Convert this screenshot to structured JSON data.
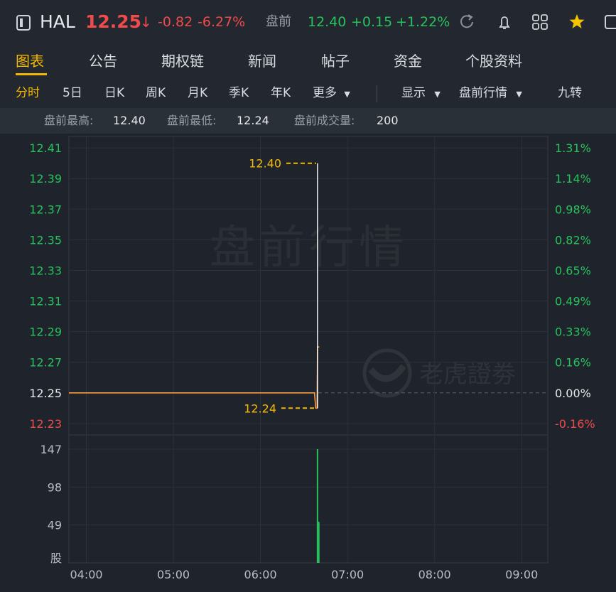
{
  "header": {
    "symbol": "HAL",
    "price": "12.25",
    "arrow": "↓",
    "change": "-0.82",
    "change_pct": "-6.27%",
    "session_label": "盘前",
    "session_price": "12.40",
    "session_change": "+0.15",
    "session_change_pct": "+1.22%"
  },
  "tabs": [
    {
      "label": "图表"
    },
    {
      "label": "公告"
    },
    {
      "label": "期权链"
    },
    {
      "label": "新闻"
    },
    {
      "label": "帖子"
    },
    {
      "label": "资金"
    },
    {
      "label": "个股资料"
    }
  ],
  "periods": [
    {
      "label": "分时"
    },
    {
      "label": "5日"
    },
    {
      "label": "日K"
    },
    {
      "label": "周K"
    },
    {
      "label": "月K"
    },
    {
      "label": "季K"
    },
    {
      "label": "年K"
    },
    {
      "label": "更多"
    }
  ],
  "options": {
    "display_label": "显示",
    "session_label": "盘前行情",
    "nine_turn_label": "九转"
  },
  "info": {
    "high_label": "盘前最高:",
    "high_value": "12.40",
    "low_label": "盘前最低:",
    "low_value": "12.24",
    "volume_label": "盘前成交量:",
    "volume_value": "200"
  },
  "watermarks": {
    "session": "盘前行情",
    "brand": "老虎證劵"
  },
  "colors": {
    "up": "#27c25c",
    "down": "#f04a4a",
    "accent": "#f5b800",
    "price_line": "#ff9a3c",
    "background": "#1f242c"
  },
  "chart_data": {
    "type": "line",
    "title": "",
    "x_ticks": [
      "04:00",
      "05:00",
      "06:00",
      "07:00",
      "08:00",
      "09:00"
    ],
    "y_ticks": [
      {
        "price": "12.41",
        "pct": "1.31%"
      },
      {
        "price": "12.39",
        "pct": "1.14%"
      },
      {
        "price": "12.37",
        "pct": "0.98%"
      },
      {
        "price": "12.35",
        "pct": "0.82%"
      },
      {
        "price": "12.33",
        "pct": "0.65%"
      },
      {
        "price": "12.31",
        "pct": "0.49%"
      },
      {
        "price": "12.29",
        "pct": "0.33%"
      },
      {
        "price": "12.27",
        "pct": "0.16%"
      },
      {
        "price": "12.25",
        "pct": "0.00%"
      },
      {
        "price": "12.23",
        "pct": "-0.16%"
      }
    ],
    "ylim": [
      12.2225,
      12.4175
    ],
    "xlim_hours": [
      3.8,
      9.3
    ],
    "prev_close": 12.25,
    "price_series": {
      "hours": [
        3.8,
        6.62,
        6.635,
        6.65,
        6.655,
        6.665,
        6.675
      ],
      "values": [
        12.25,
        12.25,
        12.24,
        12.24,
        12.28,
        12.28,
        12.28
      ]
    },
    "white_tick": {
      "hour": 6.655,
      "from": 12.24,
      "to": 12.4
    },
    "high_marker": {
      "label": "12.40",
      "value": 12.4
    },
    "low_marker": {
      "label": "12.24",
      "value": 12.24
    },
    "volume": {
      "unit_label": "股",
      "y_ticks": [
        "147",
        "98",
        "49"
      ],
      "ymax": 147,
      "bars": [
        {
          "hour": 6.655,
          "value": 147
        },
        {
          "hour": 6.67,
          "value": 53
        }
      ]
    }
  }
}
